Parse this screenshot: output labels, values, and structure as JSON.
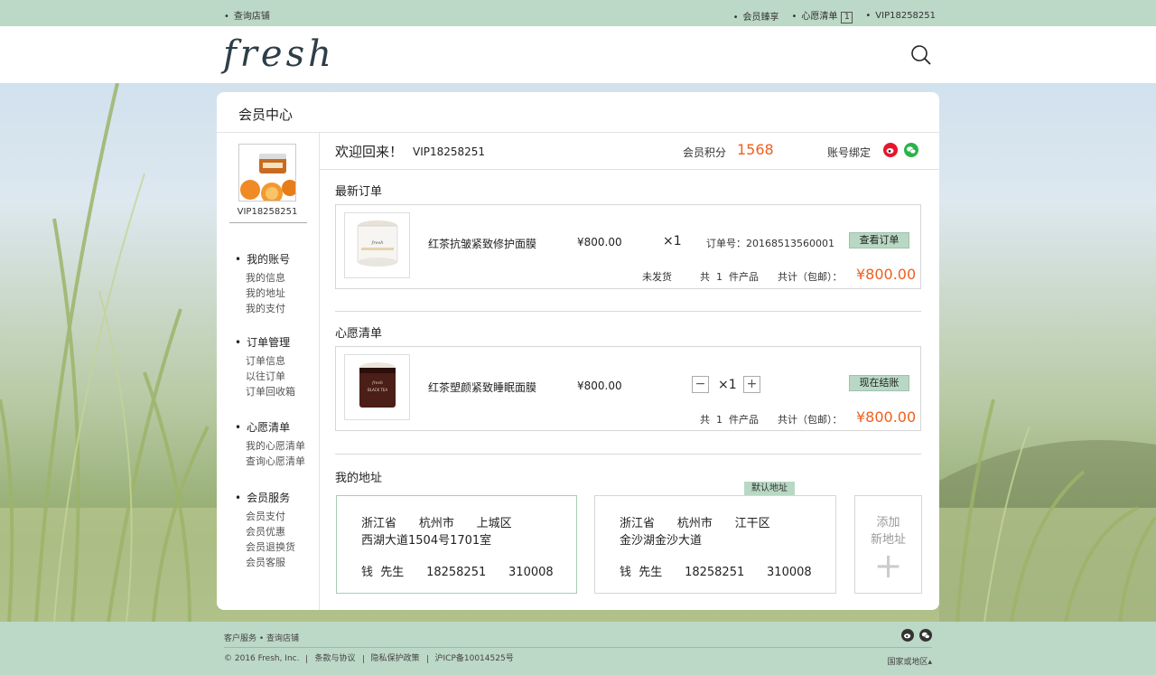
{
  "topbar": {
    "find_store": "查询店铺",
    "member_perks": "会员臻享",
    "wishlist": "心愿清单",
    "wishlist_count": "1",
    "user_id": "VIP18258251"
  },
  "header": {
    "logo": "fresh",
    "search_icon": "search-icon"
  },
  "panel": {
    "title": "会员中心"
  },
  "sidebar": {
    "user_id": "VIP18258251",
    "groups": [
      {
        "title": "我的账号",
        "items": [
          "我的信息",
          "我的地址",
          "我的支付"
        ]
      },
      {
        "title": "订单管理",
        "items": [
          "订单信息",
          "以往订单",
          "订单回收箱"
        ]
      },
      {
        "title": "心愿清单",
        "items": [
          "我的心愿清单",
          "查询心愿清单"
        ]
      },
      {
        "title": "会员服务",
        "items": [
          "会员支付",
          "会员优惠",
          "会员退换货",
          "会员客服"
        ]
      }
    ]
  },
  "welcome": {
    "greeting": "欢迎回来！",
    "user_id": "VIP18258251",
    "points_label": "会员积分",
    "points_value": "1568",
    "bind_label": "账号绑定",
    "bind_icons": [
      "weibo-icon",
      "wechat-icon"
    ]
  },
  "latest_order": {
    "title": "最新订单",
    "product_name": "红茶抗皱紧致修护面膜",
    "price": "¥800.00",
    "quantity": "×1",
    "order_no": "订单号：20168513560001",
    "view_button": "查看订单",
    "status": "未发货",
    "count_prefix": "共",
    "count": "1",
    "count_suffix": "件产品",
    "total_label": "共计（包邮）：",
    "total": "¥800.00"
  },
  "wishlist": {
    "title": "心愿清单",
    "product_name": "红茶塑颜紧致睡眠面膜",
    "price": "¥800.00",
    "minus": "−",
    "quantity": "×1",
    "plus": "+",
    "checkout_button": "现在结账",
    "count_prefix": "共",
    "count": "1",
    "count_suffix": "件产品",
    "total_label": "共计（包邮）：",
    "total": "¥800.00"
  },
  "addresses": {
    "title": "我的地址",
    "default_tag": "默认地址",
    "list": [
      {
        "province": "浙江省",
        "city": "杭州市",
        "district": "上城区",
        "street": "西湖大道1504号1701室",
        "name": "钱  先生",
        "phone": "18258251",
        "zip": "310008"
      },
      {
        "province": "浙江省",
        "city": "杭州市",
        "district": "江干区",
        "street": "金沙湖金沙大道",
        "name": "钱  先生",
        "phone": "18258251",
        "zip": "310008"
      }
    ],
    "add_line1": "添加",
    "add_line2": "新地址",
    "add_plus": "+"
  },
  "footer": {
    "service": "客户服务 • 查询店铺",
    "copyright": "© 2016 Fresh, Inc.",
    "terms": "条款与协议",
    "privacy": "隐私保护政策",
    "icp": "沪ICP备10014525号",
    "region": "国家或地区▴",
    "social_icons": [
      "weibo-icon",
      "wechat-icon"
    ]
  },
  "colors": {
    "accent": "#f0601c",
    "mint": "#bcd8c6",
    "button": "#b8d8c4"
  }
}
